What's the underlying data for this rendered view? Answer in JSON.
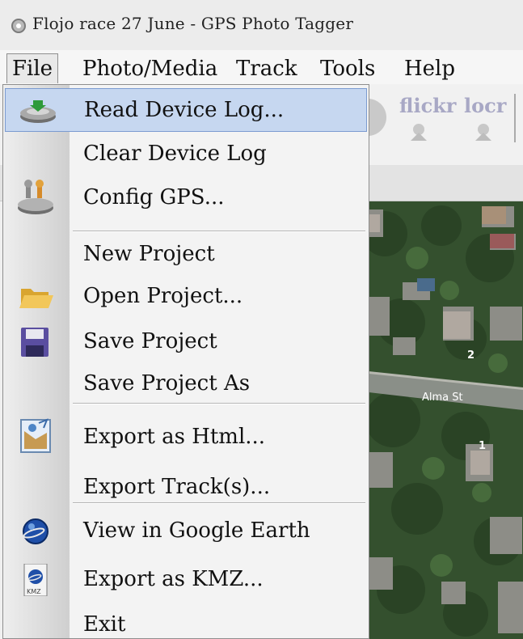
{
  "window": {
    "title": "Flojo race 27 June - GPS Photo Tagger"
  },
  "menubar": {
    "file": "File",
    "photo_media": "Photo/Media",
    "track": "Track",
    "tools": "Tools",
    "help": "Help"
  },
  "toolbar": {
    "flickr": "flickr",
    "locr": "locr"
  },
  "map": {
    "street_label": "Alma St",
    "marker_1": "1",
    "marker_2": "2"
  },
  "file_menu": {
    "read_device_log": "Read Device Log...",
    "clear_device_log": "Clear Device Log",
    "config_gps": "Config GPS...",
    "new_project": "New Project",
    "open_project": "Open Project...",
    "save_project": "Save Project",
    "save_project_as": "Save Project As",
    "export_html": "Export as Html...",
    "export_tracks": "Export Track(s)...",
    "view_google_earth": "View in Google Earth",
    "export_kmz": "Export as KMZ...",
    "exit": "Exit",
    "kmz_icon_text": "KMZ"
  },
  "colors": {
    "highlight": "#c6d7f0",
    "highlight_border": "#7b9bd0"
  }
}
